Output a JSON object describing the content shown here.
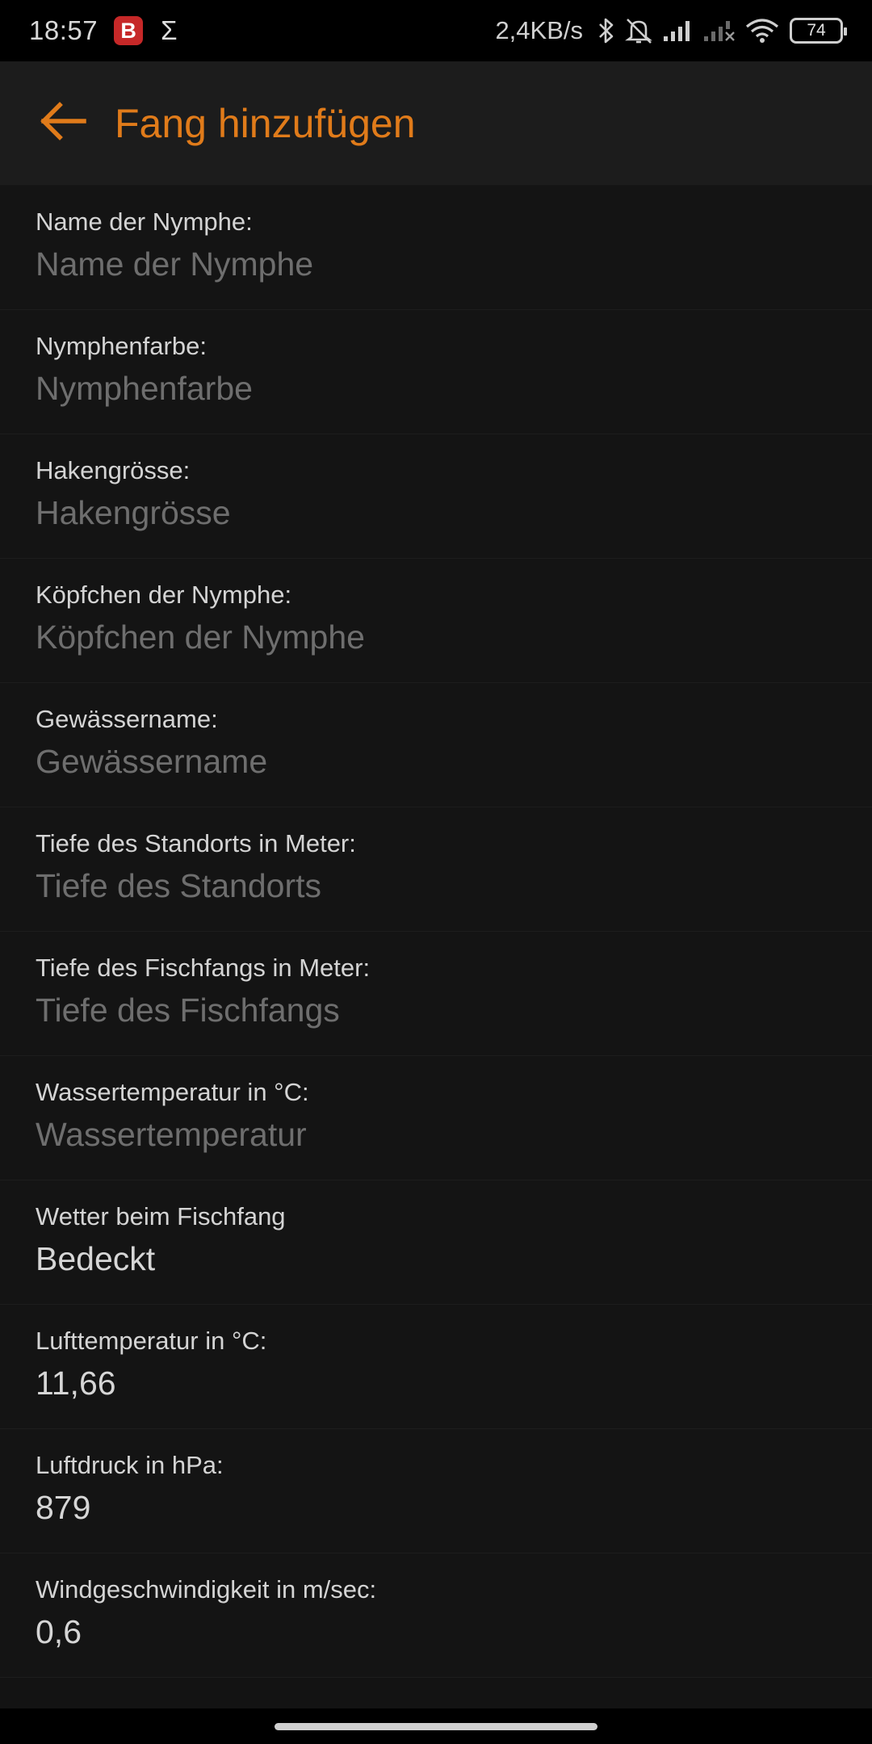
{
  "status": {
    "time": "18:57",
    "badge": "B",
    "sigma": "Σ",
    "netspeed": "2,4KB/s",
    "battery": "74"
  },
  "appbar": {
    "title": "Fang hinzufügen"
  },
  "form": {
    "fields": [
      {
        "label": "Name der Nymphe:",
        "placeholder": "Name der Nymphe",
        "value": ""
      },
      {
        "label": "Nymphenfarbe:",
        "placeholder": "Nymphenfarbe",
        "value": ""
      },
      {
        "label": "Hakengrösse:",
        "placeholder": "Hakengrösse",
        "value": ""
      },
      {
        "label": "Köpfchen der Nymphe:",
        "placeholder": "Köpfchen der Nymphe",
        "value": ""
      },
      {
        "label": "Gewässername:",
        "placeholder": "Gewässername",
        "value": ""
      },
      {
        "label": "Tiefe des Standorts in Meter:",
        "placeholder": "Tiefe des Standorts",
        "value": ""
      },
      {
        "label": "Tiefe des Fischfangs in Meter:",
        "placeholder": "Tiefe des Fischfangs",
        "value": ""
      },
      {
        "label": "Wassertemperatur in °C:",
        "placeholder": "Wassertemperatur",
        "value": ""
      },
      {
        "label": "Wetter beim Fischfang",
        "value": "Bedeckt"
      },
      {
        "label": "Lufttemperatur in °C:",
        "value": "11,66"
      },
      {
        "label": "Luftdruck in hPa:",
        "value": "879"
      },
      {
        "label": "Windgeschwindigkeit in m/sec:",
        "value": "0,6"
      }
    ]
  },
  "colors": {
    "accent": "#e07b1a",
    "background": "#131313",
    "appbar": "#1c1c1c"
  },
  "icons": {
    "back": "arrow-left-icon",
    "bluetooth": "bluetooth-icon",
    "alarm_off": "alarm-off-icon",
    "signal": "cell-signal-icon",
    "wifi": "wifi-icon"
  }
}
